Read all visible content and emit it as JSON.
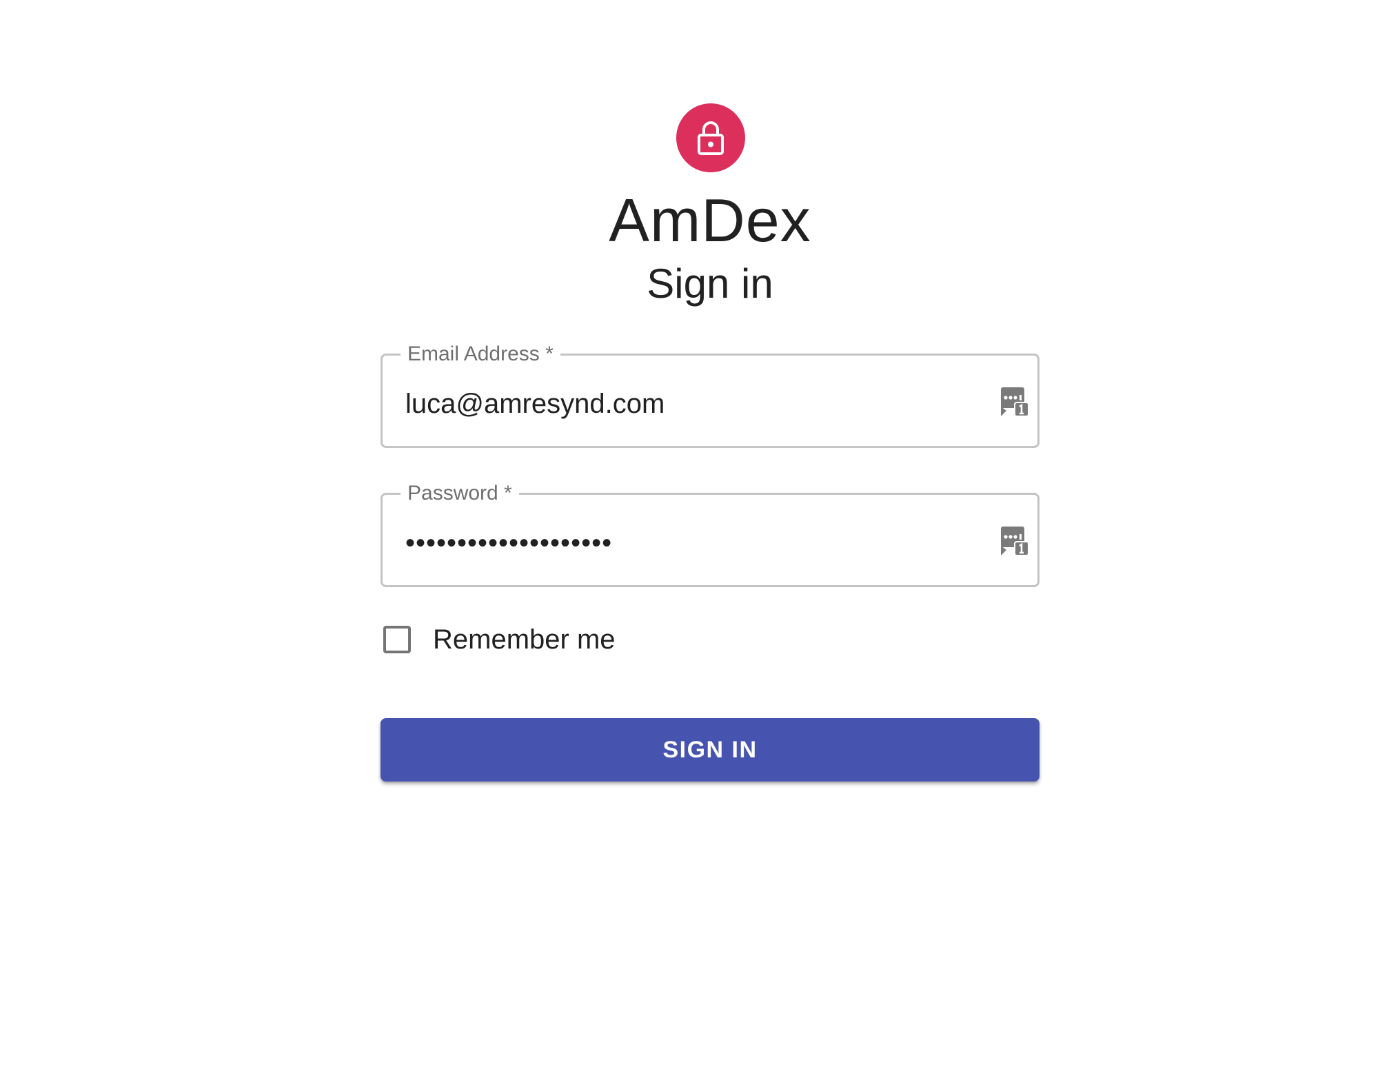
{
  "brand": {
    "title": "AmDex",
    "subtitle": "Sign in",
    "avatar_icon": "lock-icon",
    "avatar_color": "#dc2f5b"
  },
  "form": {
    "email": {
      "label": "Email Address *",
      "value": "luca@amresynd.com",
      "manager_icon": "password-manager-icon"
    },
    "password": {
      "label": "Password *",
      "value": "••••••••••••••••••••",
      "manager_icon": "password-manager-icon"
    },
    "remember_label": "Remember me",
    "remember_checked": false,
    "submit_label": "SIGN IN",
    "submit_color": "#4654b0"
  }
}
